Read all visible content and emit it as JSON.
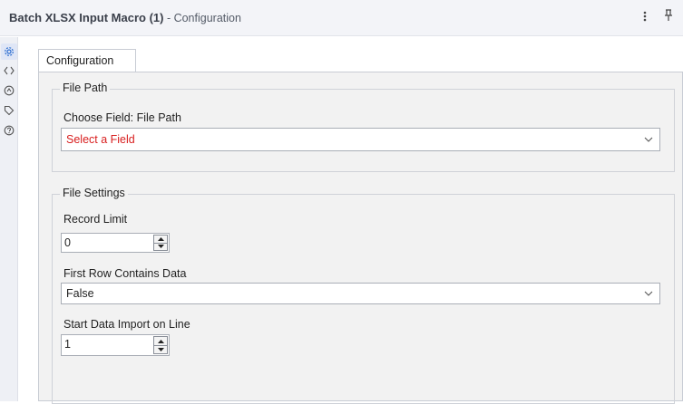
{
  "window": {
    "title": "Batch XLSX Input Macro (1)",
    "subtitle": " - Configuration"
  },
  "sidebar": {
    "icons": [
      "gear-icon",
      "code-icon",
      "circle-arrow-icon",
      "tag-icon",
      "help-icon"
    ]
  },
  "tab": {
    "label": "Configuration"
  },
  "file_path": {
    "group_title": "File Path",
    "field_label": "Choose Field: File Path",
    "select_value": "Select a Field"
  },
  "file_settings": {
    "group_title": "File Settings",
    "record_limit_label": "Record Limit",
    "record_limit_value": "0",
    "first_row_label": "First Row Contains Data",
    "first_row_value": "False",
    "start_line_label": "Start Data Import on Line",
    "start_line_value": "1"
  },
  "colors": {
    "placeholder": "#d81e1e",
    "accent": "#2e6fd1"
  }
}
